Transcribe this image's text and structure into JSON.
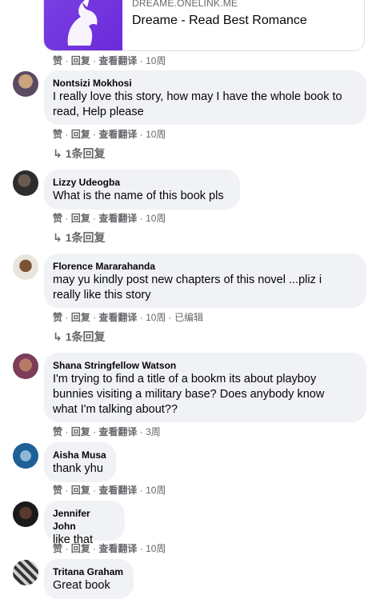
{
  "link_card": {
    "domain": "DREAME.ONELINK.ME",
    "title": "Dreame - Read Best Romance"
  },
  "action_labels": {
    "like": "赞",
    "reply": "回复",
    "translate": "查看翻译",
    "sep": " · "
  },
  "top_actions": {
    "time": "10周"
  },
  "comments": [
    {
      "author": "Nontsizi Mokhosi",
      "lines": [
        "I really love this story, how may I have the whole book to",
        "read, Help please"
      ],
      "time": "10周",
      "replies": "1条回复"
    },
    {
      "author": "Lizzy Udeogba",
      "lines": [
        "What is the name of this book pls"
      ],
      "time": "10周",
      "replies": "1条回复"
    },
    {
      "author": "Florence Mararahanda",
      "lines": [
        "may yu kindly post new chapters of this novel ...pliz i",
        "really like this story"
      ],
      "time": "10周",
      "edited": "已编辑",
      "replies": "1条回复"
    },
    {
      "author": "Shana Stringfellow Watson",
      "lines": [
        "I'm trying to find a title of a bookm its about playboy",
        "bunnies visiting a military base? Does anybody know",
        "what I'm talking about??"
      ],
      "time": "3周"
    },
    {
      "author": "Aisha Musa",
      "lines": [
        "thank yhu"
      ],
      "time": "10周"
    },
    {
      "author": "Jennifer John",
      "lines": [
        "like that"
      ],
      "time": "10周"
    },
    {
      "author": "Tritana Graham",
      "lines": [
        "Great book"
      ]
    }
  ],
  "icons": {
    "reply_arrow": "reply-arrow-icon"
  }
}
